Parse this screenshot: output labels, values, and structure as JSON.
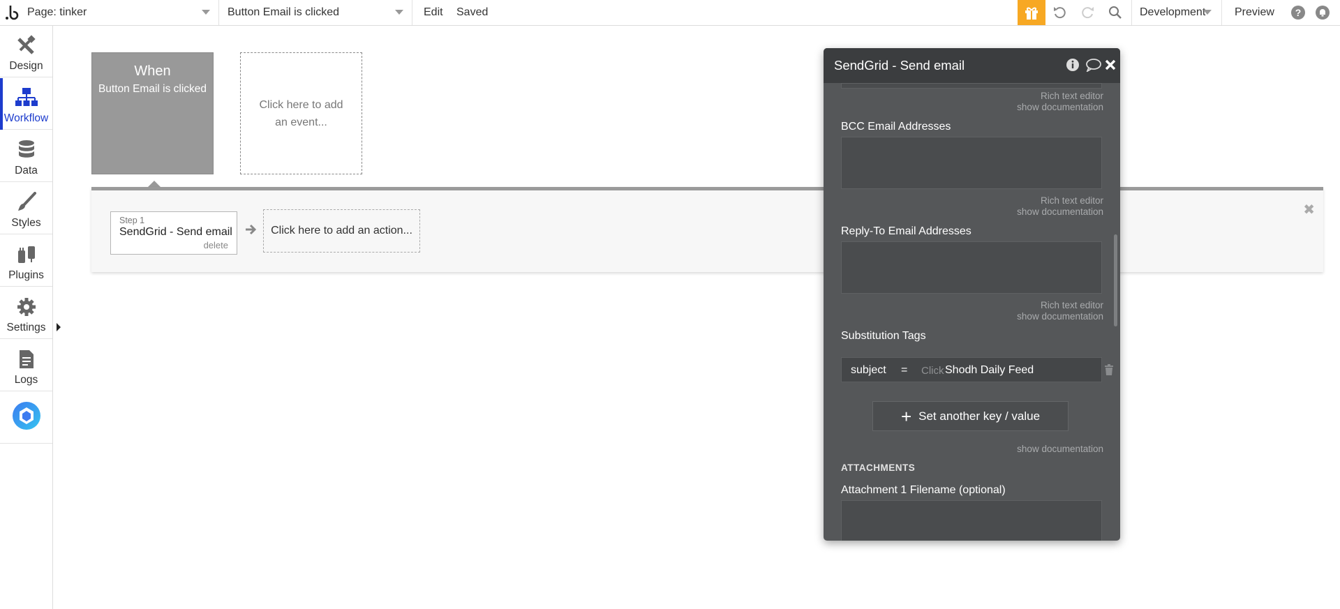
{
  "topbar": {
    "page_label": "Page: tinker",
    "event_label": "Button Email is clicked",
    "edit_label": "Edit",
    "save_status": "Saved",
    "environment": "Development",
    "preview_label": "Preview"
  },
  "sidebar": {
    "items": [
      {
        "label": "Design",
        "icon": "design-icon"
      },
      {
        "label": "Workflow",
        "icon": "workflow-icon",
        "active": true
      },
      {
        "label": "Data",
        "icon": "database-icon"
      },
      {
        "label": "Styles",
        "icon": "brush-icon"
      },
      {
        "label": "Plugins",
        "icon": "plug-icon"
      },
      {
        "label": "Settings",
        "icon": "gear-icon"
      },
      {
        "label": "Logs",
        "icon": "document-icon"
      }
    ]
  },
  "canvas": {
    "when_title": "When",
    "when_event": "Button Email is clicked",
    "add_event": "Click here to add an event...",
    "step_label": "Step 1",
    "step_name": "SendGrid - Send email",
    "step_delete": "delete",
    "add_action": "Click here to add an action..."
  },
  "panel": {
    "title": "SendGrid - Send email",
    "rich_text_editor": "Rich text editor",
    "show_documentation": "show documentation",
    "bcc_label": "BCC Email Addresses",
    "reply_to_label": "Reply-To Email Addresses",
    "substitution_label": "Substitution Tags",
    "substitution": {
      "key": "subject",
      "operator": "=",
      "placeholder": "Click",
      "value": "Shodh Daily Feed"
    },
    "set_another_label": "Set another key / value",
    "attachments_heading": "ATTACHMENTS",
    "attachment1_label": "Attachment 1 Filename (optional)"
  },
  "colors": {
    "accent_blue": "#1d3ccd",
    "gift_orange": "#f7a823",
    "panel_bg": "#555759",
    "panel_header": "#3b3d3f"
  }
}
